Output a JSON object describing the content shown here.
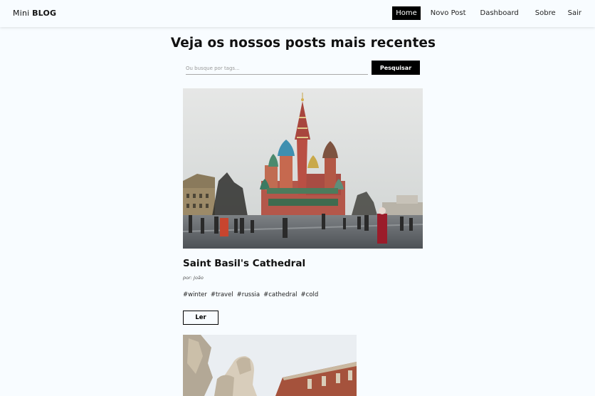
{
  "brand": {
    "prefix": "Mini",
    "strong": "BLOG"
  },
  "nav": {
    "home": "Home",
    "novo_post": "Novo Post",
    "dashboard": "Dashboard",
    "sobre": "Sobre",
    "sair": "Sair"
  },
  "page": {
    "title": "Veja os nossos posts mais recentes"
  },
  "search": {
    "placeholder": "Ou busque por tags...",
    "button": "Pesquisar"
  },
  "posts": [
    {
      "title": "Saint Basil's Cathedral",
      "author": "por: João",
      "tags": [
        "#winter",
        "#travel",
        "#russia",
        "#cathedral",
        "#cold"
      ],
      "read_label": "Ler",
      "image": "cathedral-photo"
    },
    {
      "image": "statue-fountain-photo"
    }
  ],
  "colors": {
    "background": "#f8fcff",
    "accent": "#000000"
  }
}
